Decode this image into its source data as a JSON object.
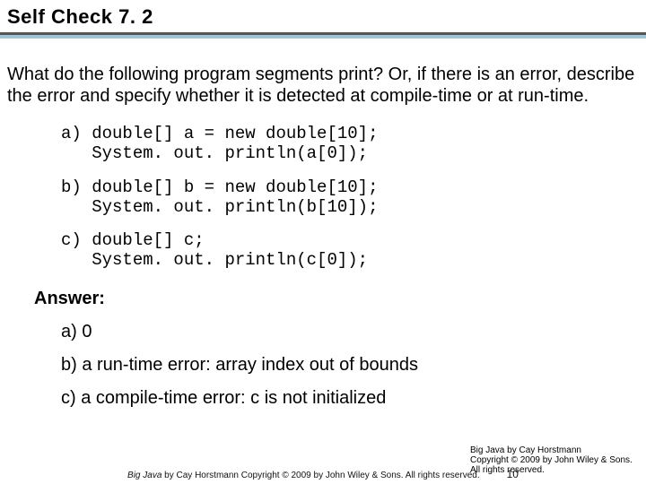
{
  "heading": "Self Check 7. 2",
  "question": "What do the following program segments print? Or, if there is an error, describe the error and specify whether it is detected at compile-time or at run-time.",
  "segments": [
    {
      "label": "a)",
      "line1": "double[] a = new double[10];",
      "line2": "System. out. println(a[0]);"
    },
    {
      "label": "b)",
      "line1": "double[] b = new double[10];",
      "line2": "System. out. println(b[10]);"
    },
    {
      "label": "c)",
      "line1": "double[] c;",
      "line2": "System. out. println(c[0]);"
    }
  ],
  "answer_label": "Answer:",
  "answers": [
    "a) 0",
    "b) a run-time error: array index out of bounds",
    "c) a compile-time error: c is not initialized"
  ],
  "footer": {
    "book_title": "Big Java",
    "byline": "by Cay Horstmann",
    "copyright": "Copyright © 2009 by John Wiley & Sons. All rights reserved.",
    "page_number": "10"
  }
}
